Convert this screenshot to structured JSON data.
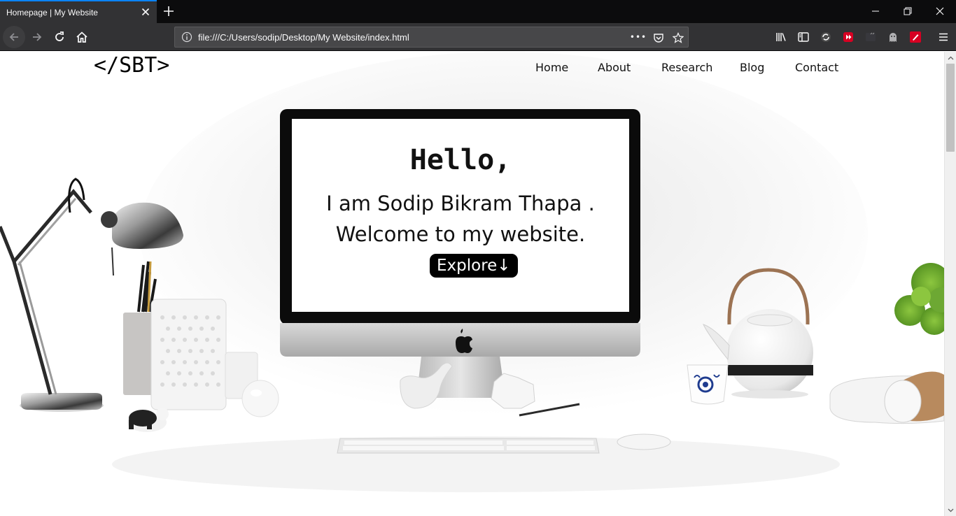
{
  "browser": {
    "tab_title": "Homepage | My Website",
    "url": "file:///C:/Users/sodip/Desktop/My Website/index.html",
    "url_more": "•••"
  },
  "site": {
    "logo": "</SBT>",
    "nav": [
      "Home",
      "About",
      "Research",
      "Blog",
      "Contact"
    ]
  },
  "hero": {
    "greeting": "Hello,",
    "intro": "I am Sodip Bikram Thapa .",
    "welcome": "Welcome to my website.",
    "cta": "Explore↓"
  }
}
